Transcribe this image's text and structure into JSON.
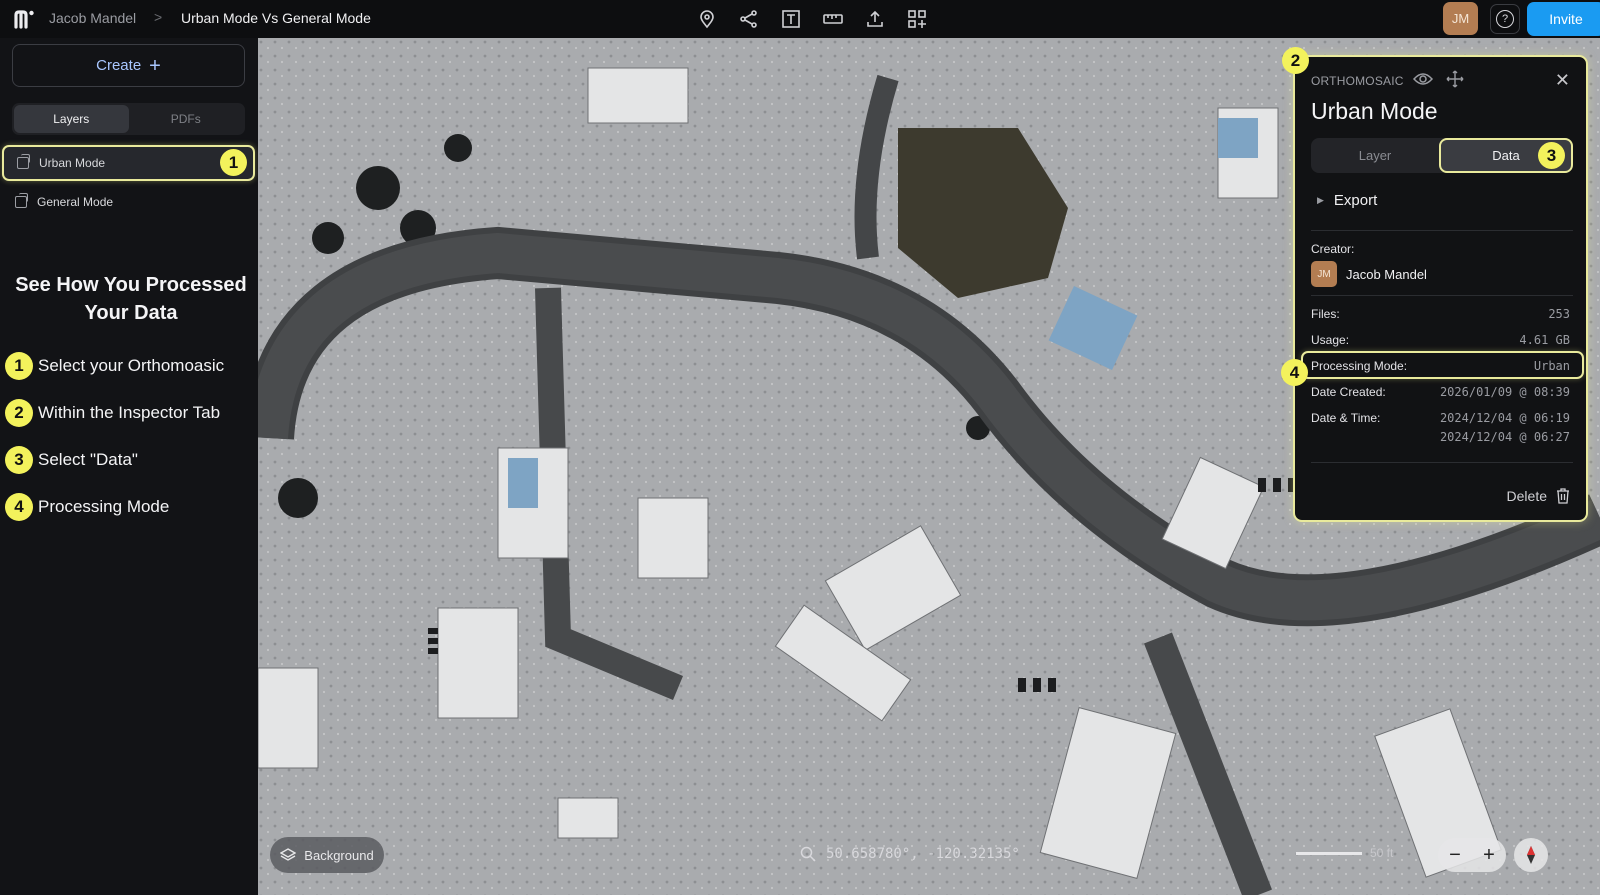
{
  "topbar": {
    "breadcrumb_user": "Jacob Mandel",
    "breadcrumb_separator": ">",
    "breadcrumb_page": "Urban Mode Vs General Mode",
    "avatar_initials": "JM",
    "help_glyph": "?",
    "invite_label": "Invite",
    "tool_icons": [
      "pin-icon",
      "share-nodes-icon",
      "text-frame-icon",
      "ruler-icon",
      "upload-icon",
      "grid-plus-icon"
    ]
  },
  "sidebar": {
    "create_label": "Create",
    "create_glyph": "+",
    "tabs": [
      {
        "label": "Layers",
        "active": true
      },
      {
        "label": "PDFs",
        "active": false
      }
    ],
    "layers": [
      {
        "label": "Urban Mode",
        "active": true,
        "badge": "1"
      },
      {
        "label": "General Mode",
        "active": false
      }
    ],
    "howto": {
      "title_line1": "See How You Processed",
      "title_line2": "Your Data",
      "steps": [
        {
          "num": "1",
          "text": "Select your Orthomoasic"
        },
        {
          "num": "2",
          "text": "Within the Inspector Tab"
        },
        {
          "num": "3",
          "text": "Select \"Data\""
        },
        {
          "num": "4",
          "text": "Processing Mode"
        }
      ]
    }
  },
  "map": {
    "background_label": "Background",
    "coordinates": "50.658780°, -120.32135°",
    "scale_label": "50 ft",
    "zoom_out": "−",
    "zoom_in": "+"
  },
  "inspector": {
    "badge": "2",
    "type_label": "ORTHOMOSAIC",
    "title": "Urban Mode",
    "tabs": [
      {
        "label": "Layer",
        "active": false
      },
      {
        "label": "Data",
        "active": true,
        "badge": "3"
      }
    ],
    "export_label": "Export",
    "creator_label": "Creator:",
    "creator_initials": "JM",
    "creator_name": "Jacob Mandel",
    "rows": [
      {
        "label": "Files:",
        "value": "253"
      },
      {
        "label": "Usage:",
        "value": "4.61 GB"
      },
      {
        "label": "Processing Mode:",
        "value": "Urban",
        "badge": "4"
      },
      {
        "label": "Date Created:",
        "value": "2026/01/09 @ 08:39"
      },
      {
        "label": "Date & Time:",
        "value": "2024/12/04 @ 06:19",
        "value2": "2024/12/04 @ 06:27"
      }
    ],
    "delete_label": "Delete"
  },
  "colors": {
    "accent_blue": "#1a9bf2",
    "highlight_yellow": "#f3f25c",
    "avatar": "#b37d52"
  }
}
